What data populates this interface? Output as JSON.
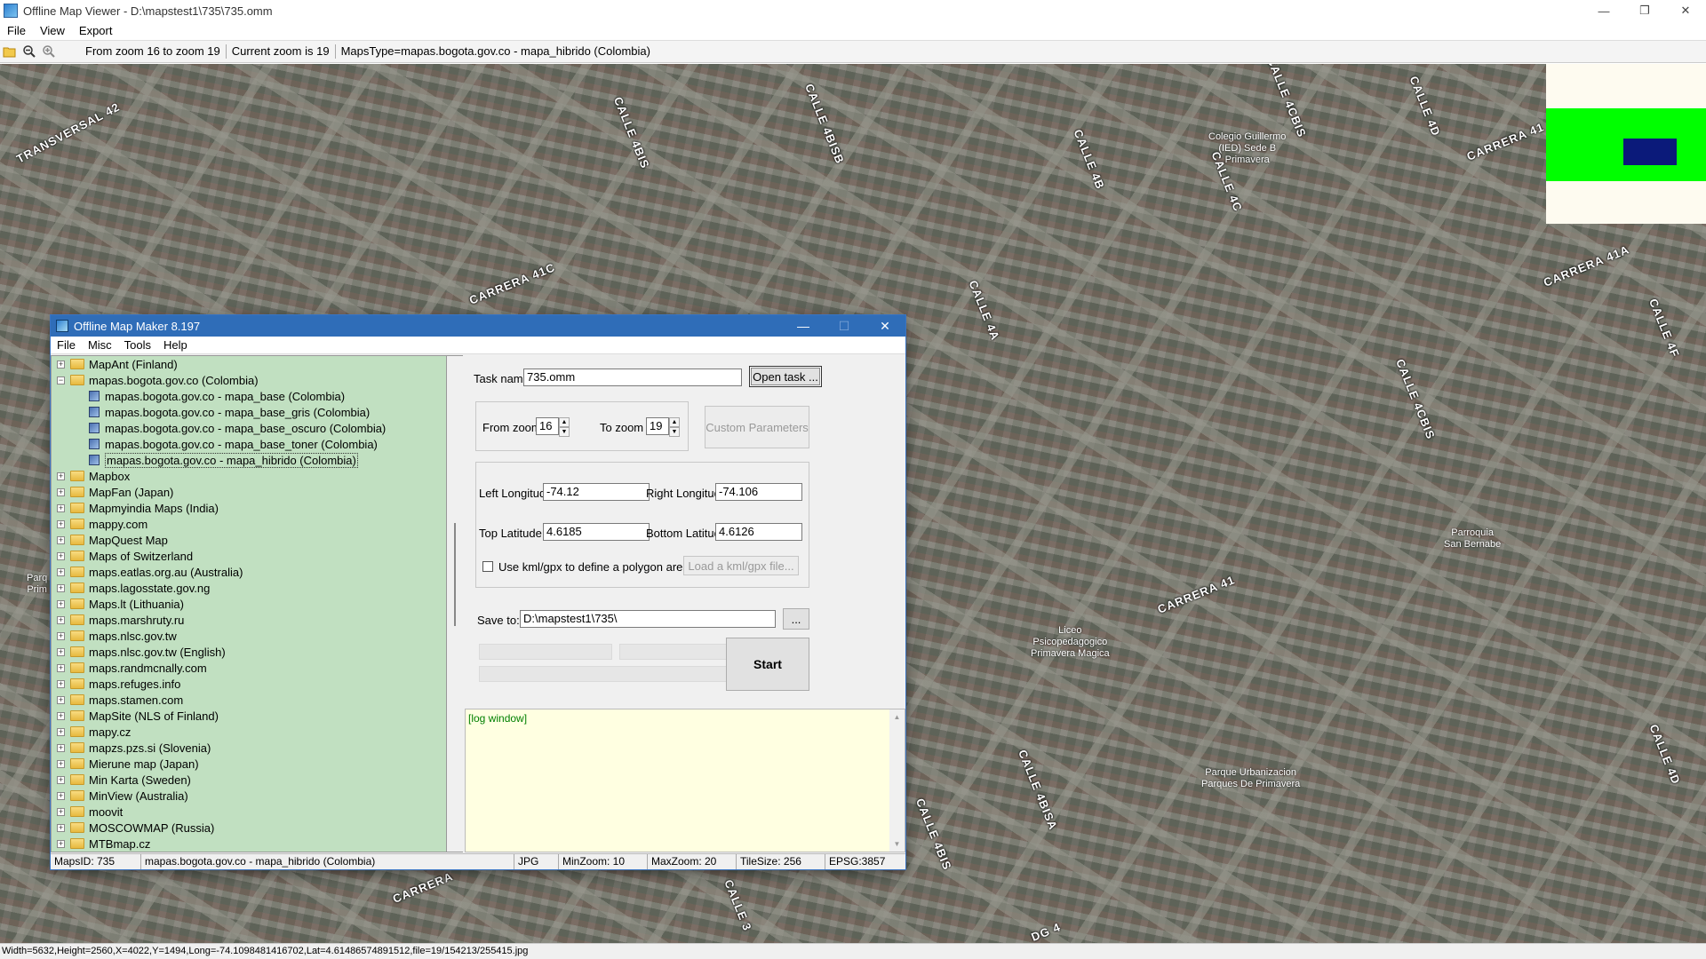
{
  "main_window": {
    "title": "Offline Map Viewer - D:\\mapstest1\\735\\735.omm",
    "menu": [
      "File",
      "View",
      "Export"
    ],
    "toolbar": {
      "icons": [
        "open-folder-icon",
        "zoom-out-icon",
        "zoom-in-icon"
      ],
      "zoom_range": "From zoom 16 to zoom 19",
      "current_zoom": "Current zoom is 19",
      "maps_type": "MapsType=mapas.bogota.gov.co - mapa_hibrido (Colombia)"
    },
    "status": "Width=5632,Height=2560,X=4022,Y=1494,Long=-74.1098481416702,Lat=4.61486574891512,file=19/154213/255415.jpg"
  },
  "map": {
    "street_labels": [
      "TRANSVERSAL 42",
      "CALLE 4BIS",
      "CALLE 4BISB",
      "CARRERA 41C",
      "CALLE 4A",
      "CALLE 4B",
      "CALLE 4CBIS",
      "CALLE 4C",
      "CALLE 4D",
      "CARRERA 41",
      "CARRERA 41A",
      "CALLE 4F",
      "CALLE 4CBIS",
      "CARRERA 41",
      "CALLE 4BISA",
      "CALLE 4BIS",
      "CARRERA",
      "CALLE 3",
      "DG 4",
      "CALLE 4D"
    ],
    "poi_labels": [
      {
        "lines": [
          "Colegio Guillermo",
          "(IED) Sede B",
          "Primavera"
        ]
      },
      {
        "lines": [
          "Parroquia",
          "San Bernabe"
        ]
      },
      {
        "lines": [
          "Liceo",
          "Psicopedagogico",
          "Primavera Magica"
        ]
      },
      {
        "lines": [
          "Parque Urbanizacion",
          "Parques De Primavera"
        ]
      },
      {
        "lines": [
          "Parq",
          "Prim"
        ]
      }
    ]
  },
  "overview": {
    "band_color": "#00ff00",
    "view_color": "#0b1a7a",
    "bg_color": "#fefbf0"
  },
  "dialog": {
    "title": "Offline Map Maker 8.197",
    "menu": [
      "File",
      "Misc",
      "Tools",
      "Help"
    ],
    "tree": {
      "items": [
        {
          "label": "MapAnt (Finland)",
          "type": "folder",
          "expander": "+"
        },
        {
          "label": "mapas.bogota.gov.co (Colombia)",
          "type": "folder-open",
          "expander": "−"
        },
        {
          "label": "mapas.bogota.gov.co - mapa_base (Colombia)",
          "type": "map",
          "child": true
        },
        {
          "label": "mapas.bogota.gov.co - mapa_base_gris (Colombia)",
          "type": "map",
          "child": true
        },
        {
          "label": "mapas.bogota.gov.co - mapa_base_oscuro (Colombia)",
          "type": "map",
          "child": true
        },
        {
          "label": "mapas.bogota.gov.co - mapa_base_toner (Colombia)",
          "type": "map",
          "child": true
        },
        {
          "label": "mapas.bogota.gov.co - mapa_hibrido (Colombia)",
          "type": "map",
          "child": true,
          "selected": true
        },
        {
          "label": "Mapbox",
          "type": "folder",
          "expander": "+"
        },
        {
          "label": "MapFan (Japan)",
          "type": "folder",
          "expander": "+"
        },
        {
          "label": "Mapmyindia Maps (India)",
          "type": "folder",
          "expander": "+"
        },
        {
          "label": "mappy.com",
          "type": "folder",
          "expander": "+"
        },
        {
          "label": "MapQuest Map",
          "type": "folder",
          "expander": "+"
        },
        {
          "label": "Maps of Switzerland",
          "type": "folder",
          "expander": "+"
        },
        {
          "label": "maps.eatlas.org.au (Australia)",
          "type": "folder",
          "expander": "+"
        },
        {
          "label": "maps.lagosstate.gov.ng",
          "type": "folder",
          "expander": "+"
        },
        {
          "label": "Maps.lt (Lithuania)",
          "type": "folder",
          "expander": "+"
        },
        {
          "label": "maps.marshruty.ru",
          "type": "folder",
          "expander": "+"
        },
        {
          "label": "maps.nlsc.gov.tw",
          "type": "folder",
          "expander": "+"
        },
        {
          "label": "maps.nlsc.gov.tw (English)",
          "type": "folder",
          "expander": "+"
        },
        {
          "label": "maps.randmcnally.com",
          "type": "folder",
          "expander": "+"
        },
        {
          "label": "maps.refuges.info",
          "type": "folder",
          "expander": "+"
        },
        {
          "label": "maps.stamen.com",
          "type": "folder",
          "expander": "+"
        },
        {
          "label": "MapSite (NLS of Finland)",
          "type": "folder",
          "expander": "+"
        },
        {
          "label": "mapy.cz",
          "type": "folder",
          "expander": "+"
        },
        {
          "label": "mapzs.pzs.si (Slovenia)",
          "type": "folder",
          "expander": "+"
        },
        {
          "label": "Mierune map (Japan)",
          "type": "folder",
          "expander": "+"
        },
        {
          "label": "Min Karta (Sweden)",
          "type": "folder",
          "expander": "+"
        },
        {
          "label": "MinView (Australia)",
          "type": "folder",
          "expander": "+"
        },
        {
          "label": "moovit",
          "type": "folder",
          "expander": "+"
        },
        {
          "label": "MOSCOWMAP (Russia)",
          "type": "folder",
          "expander": "+"
        },
        {
          "label": "MTBmap.cz",
          "type": "folder",
          "expander": "+"
        }
      ]
    },
    "form": {
      "task_name_label": "Task name",
      "task_name_value": "735.omm",
      "open_task_button": "Open task ...",
      "from_zoom_label": "From zoom",
      "from_zoom_value": "16",
      "to_zoom_label": "To zoom",
      "to_zoom_value": "19",
      "custom_parameters_button": "Custom Parameters",
      "left_longitude_label": "Left Longitude",
      "left_longitude_value": "-74.12",
      "right_longitude_label": "Right Longitude",
      "right_longitude_value": "-74.106",
      "top_latitude_label": "Top Latitude",
      "top_latitude_value": "4.6185",
      "bottom_latitude_label": "Bottom Latitude",
      "bottom_latitude_value": "4.6126",
      "kml_checkbox_label": "Use kml/gpx to define a polygon area",
      "load_kml_button": "Load a kml/gpx file...",
      "save_to_label": "Save to:",
      "save_to_value": "D:\\mapstest1\\735\\",
      "browse_button": "...",
      "start_button": "Start",
      "log_text": "[log window]"
    },
    "status": {
      "maps_id": "MapsID: 735",
      "maps_name": "mapas.bogota.gov.co - mapa_hibrido (Colombia)",
      "format": "JPG",
      "min_zoom": "MinZoom: 10",
      "max_zoom": "MaxZoom: 20",
      "tile_size": "TileSize: 256",
      "epsg": "EPSG:3857"
    }
  }
}
